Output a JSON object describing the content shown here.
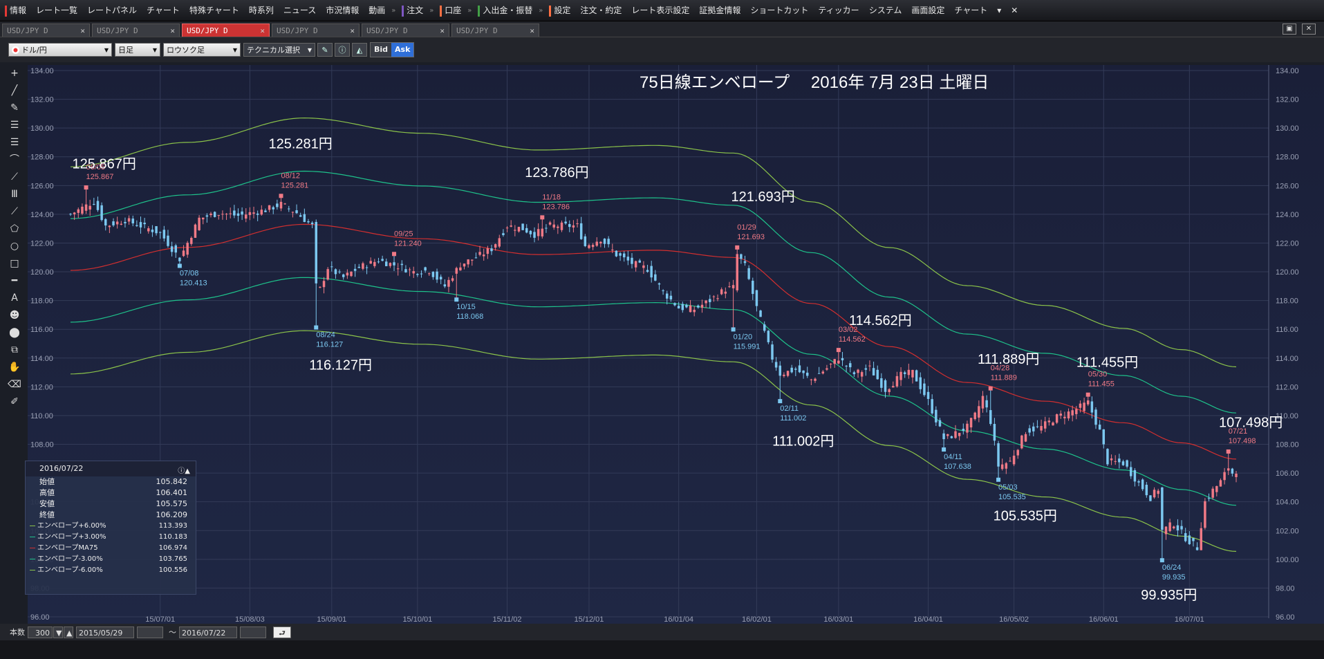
{
  "menu": {
    "items": [
      "情報",
      "レート一覧",
      "レートパネル",
      "チャート",
      "特殊チャート",
      "時系列",
      "ニュース",
      "市況情報",
      "動画",
      "注文",
      "口座",
      "入出金・振替",
      "設定",
      "注文・約定",
      "レート表示設定",
      "証拠金情報",
      "ショートカット",
      "ティッカー",
      "システム",
      "画面設定",
      "チャート"
    ],
    "close_label": "✕"
  },
  "tabs": [
    "USD/JPY D",
    "USD/JPY D",
    "USD/JPY D",
    "USD/JPY D",
    "USD/JPY D",
    "USD/JPY D"
  ],
  "active_tab": 2,
  "toolbar": {
    "pair": "ドル/円",
    "timeframe": "日足",
    "chart_type": "ロウソク足",
    "technical": "テクニカル選択",
    "bid": "Bid",
    "ask": "Ask"
  },
  "sidebar_tools": [
    "crosshair-tool",
    "trendline-tool",
    "ruler-tool",
    "parallel-lines-tool",
    "horizontal-lines-tool",
    "fibonacci-arc-tool",
    "fan-tool",
    "vertical-lines-tool",
    "channel-tool",
    "pentagon-tool",
    "circle-tool",
    "rectangle-tool",
    "hline-tool",
    "text-tool",
    "icon-tool",
    "object-tool",
    "copy-tool",
    "hand-tool",
    "eraser-tool",
    "edit-tool"
  ],
  "sidebar_glyphs": [
    "+",
    "╱",
    "✎",
    "☰",
    "☰",
    "⌒",
    "⟋",
    "Ⅲ",
    "⟋",
    "⬠",
    "○",
    "□",
    "━",
    "A",
    "☻",
    "⬤",
    "⧉",
    "✋",
    "⌫",
    "✐"
  ],
  "info_panel": {
    "date": "2016/07/22",
    "rows": [
      {
        "label": "始値",
        "value": "105.842"
      },
      {
        "label": "高値",
        "value": "106.401"
      },
      {
        "label": "安値",
        "value": "105.575"
      },
      {
        "label": "終値",
        "value": "106.209"
      }
    ],
    "series_rows": [
      {
        "label": "エンベロープ+6.00%",
        "value": "113.393",
        "color": "#8bc34a"
      },
      {
        "label": "エンベロープ+3.00%",
        "value": "110.183",
        "color": "#1ec28b"
      },
      {
        "label": "エンベロープMA75",
        "value": "106.974",
        "color": "#d32f2f"
      },
      {
        "label": "エンベロープ-3.00%",
        "value": "103.765",
        "color": "#1ec28b"
      },
      {
        "label": "エンベロープ-6.00%",
        "value": "100.556",
        "color": "#8bc34a"
      }
    ]
  },
  "bottom": {
    "count_label": "本数",
    "count_value": "300",
    "from_date": "2015/05/29",
    "tilde": "〜",
    "to_date": "2016/07/22"
  },
  "colors": {
    "up": "#f07a86",
    "down": "#7cc8f0",
    "ma": "#d32f2f",
    "env3": "#1ec28b",
    "env6": "#8bc34a",
    "bg": "#1a2038"
  },
  "chart_data": {
    "type": "candlestick",
    "title": "75日線エンベロープ　 2016年 7月 23日 土曜日",
    "ylim": [
      96,
      134
    ],
    "y_ticks": [
      "134.00",
      "132.00",
      "130.00",
      "128.00",
      "126.00",
      "124.00",
      "122.00",
      "120.00",
      "118.00",
      "116.00",
      "114.00",
      "112.00",
      "110.00",
      "108.00",
      "106.00",
      "104.00",
      "102.00",
      "100.00",
      "98.00",
      "96.00"
    ],
    "x_ticks": [
      "15/07/01",
      "15/08/03",
      "15/09/01",
      "15/10/01",
      "15/11/02",
      "15/12/01",
      "16/01/04",
      "16/02/01",
      "16/03/01",
      "16/04/01",
      "16/05/02",
      "16/06/01",
      "16/07/01"
    ],
    "x_tick_index": [
      23,
      46,
      67,
      89,
      112,
      133,
      156,
      176,
      197,
      220,
      242,
      265,
      287
    ],
    "bars": 300,
    "anchors": [
      {
        "i": 0,
        "p": 124.0
      },
      {
        "i": 6,
        "p": 124.9
      },
      {
        "i": 9,
        "p": 123.2
      },
      {
        "i": 14,
        "p": 123.6
      },
      {
        "i": 18,
        "p": 123.2
      },
      {
        "i": 23,
        "p": 122.7
      },
      {
        "i": 28,
        "p": 120.9
      },
      {
        "i": 33,
        "p": 123.7
      },
      {
        "i": 38,
        "p": 124.1
      },
      {
        "i": 43,
        "p": 123.9
      },
      {
        "i": 50,
        "p": 124.3
      },
      {
        "i": 54,
        "p": 124.7
      },
      {
        "i": 58,
        "p": 124.1
      },
      {
        "i": 62,
        "p": 123.2
      },
      {
        "i": 63,
        "p": 119.0
      },
      {
        "i": 64,
        "p": 118.8
      },
      {
        "i": 66,
        "p": 120.3
      },
      {
        "i": 70,
        "p": 119.6
      },
      {
        "i": 74,
        "p": 120.3
      },
      {
        "i": 79,
        "p": 120.8
      },
      {
        "i": 84,
        "p": 120.4
      },
      {
        "i": 88,
        "p": 120.0
      },
      {
        "i": 92,
        "p": 120.1
      },
      {
        "i": 96,
        "p": 119.0
      },
      {
        "i": 100,
        "p": 120.5
      },
      {
        "i": 104,
        "p": 121.0
      },
      {
        "i": 108,
        "p": 121.6
      },
      {
        "i": 112,
        "p": 123.2
      },
      {
        "i": 116,
        "p": 123.0
      },
      {
        "i": 119,
        "p": 122.6
      },
      {
        "i": 123,
        "p": 123.2
      },
      {
        "i": 130,
        "p": 123.2
      },
      {
        "i": 132,
        "p": 121.8
      },
      {
        "i": 136,
        "p": 122.3
      },
      {
        "i": 140,
        "p": 121.2
      },
      {
        "i": 144,
        "p": 120.6
      },
      {
        "i": 148,
        "p": 120.2
      },
      {
        "i": 152,
        "p": 118.6
      },
      {
        "i": 156,
        "p": 117.5
      },
      {
        "i": 160,
        "p": 117.4
      },
      {
        "i": 164,
        "p": 118.0
      },
      {
        "i": 168,
        "p": 118.8
      },
      {
        "i": 170,
        "p": 118.9
      },
      {
        "i": 171,
        "p": 121.2
      },
      {
        "i": 173,
        "p": 120.4
      },
      {
        "i": 176,
        "p": 117.5
      },
      {
        "i": 180,
        "p": 114.0
      },
      {
        "i": 182,
        "p": 112.9
      },
      {
        "i": 186,
        "p": 113.2
      },
      {
        "i": 190,
        "p": 112.5
      },
      {
        "i": 194,
        "p": 113.3
      },
      {
        "i": 197,
        "p": 114.0
      },
      {
        "i": 201,
        "p": 112.9
      },
      {
        "i": 205,
        "p": 113.3
      },
      {
        "i": 209,
        "p": 111.8
      },
      {
        "i": 213,
        "p": 112.8
      },
      {
        "i": 216,
        "p": 113.0
      },
      {
        "i": 220,
        "p": 111.0
      },
      {
        "i": 224,
        "p": 108.4
      },
      {
        "i": 226,
        "p": 108.6
      },
      {
        "i": 230,
        "p": 109.2
      },
      {
        "i": 232,
        "p": 110.0
      },
      {
        "i": 234,
        "p": 111.3
      },
      {
        "i": 236,
        "p": 109.6
      },
      {
        "i": 238,
        "p": 106.5
      },
      {
        "i": 241,
        "p": 106.8
      },
      {
        "i": 245,
        "p": 108.9
      },
      {
        "i": 249,
        "p": 109.2
      },
      {
        "i": 253,
        "p": 109.9
      },
      {
        "i": 256,
        "p": 110.2
      },
      {
        "i": 259,
        "p": 110.6
      },
      {
        "i": 261,
        "p": 110.9
      },
      {
        "i": 264,
        "p": 108.9
      },
      {
        "i": 266,
        "p": 106.8
      },
      {
        "i": 270,
        "p": 106.7
      },
      {
        "i": 274,
        "p": 105.3
      },
      {
        "i": 277,
        "p": 104.3
      },
      {
        "i": 279,
        "p": 104.9
      },
      {
        "i": 280,
        "p": 102.0
      },
      {
        "i": 283,
        "p": 102.5
      },
      {
        "i": 286,
        "p": 101.5
      },
      {
        "i": 289,
        "p": 100.8
      },
      {
        "i": 291,
        "p": 104.0
      },
      {
        "i": 293,
        "p": 104.8
      },
      {
        "i": 295,
        "p": 105.4
      },
      {
        "i": 297,
        "p": 106.4
      },
      {
        "i": 298,
        "p": 106.0
      },
      {
        "i": 299,
        "p": 106.2
      }
    ],
    "price_labels": [
      {
        "i": 4,
        "text": "125.867円",
        "p": 127.2,
        "dx": -20
      },
      {
        "i": 54,
        "text": "125.281円",
        "p": 128.6,
        "dx": -18
      },
      {
        "i": 63,
        "text": "116.127円",
        "p": 113.2,
        "dx": -10
      },
      {
        "i": 121,
        "text": "123.786円",
        "p": 126.6,
        "dx": -25
      },
      {
        "i": 173,
        "text": "121.693円",
        "p": 124.9,
        "dx": -20
      },
      {
        "i": 188,
        "text": "111.002円",
        "p": 107.9,
        "dx": -45
      },
      {
        "i": 205,
        "text": "114.562円",
        "p": 116.3,
        "dx": -30
      },
      {
        "i": 238,
        "text": "111.889円",
        "p": 113.6,
        "dx": -30
      },
      {
        "i": 242,
        "text": "105.535円",
        "p": 102.7,
        "dx": -30
      },
      {
        "i": 266,
        "text": "111.455円",
        "p": 113.4,
        "dx": -45
      },
      {
        "i": 279,
        "text": "99.935円",
        "p": 97.2,
        "dx": -25
      },
      {
        "i": 299,
        "text": "107.498円",
        "p": 109.2,
        "dx": -25
      }
    ],
    "peak_labels": [
      {
        "i": 4,
        "date": "06/05",
        "value": "125.867",
        "p": 125.867,
        "kind": "high"
      },
      {
        "i": 28,
        "date": "07/08",
        "value": "120.413",
        "p": 120.413,
        "kind": "low"
      },
      {
        "i": 54,
        "date": "08/12",
        "value": "125.281",
        "p": 125.281,
        "kind": "high"
      },
      {
        "i": 63,
        "date": "08/24",
        "value": "116.127",
        "p": 116.127,
        "kind": "low"
      },
      {
        "i": 83,
        "date": "09/25",
        "value": "121.240",
        "p": 121.24,
        "kind": "high"
      },
      {
        "i": 99,
        "date": "10/15",
        "value": "118.068",
        "p": 118.068,
        "kind": "low"
      },
      {
        "i": 121,
        "date": "11/18",
        "value": "123.786",
        "p": 123.786,
        "kind": "high"
      },
      {
        "i": 170,
        "date": "01/20",
        "value": "115.991",
        "p": 115.991,
        "kind": "low"
      },
      {
        "i": 171,
        "date": "01/29",
        "value": "121.693",
        "p": 121.693,
        "kind": "high"
      },
      {
        "i": 182,
        "date": "02/11",
        "value": "111.002",
        "p": 111.002,
        "kind": "low"
      },
      {
        "i": 197,
        "date": "03/02",
        "value": "114.562",
        "p": 114.562,
        "kind": "high"
      },
      {
        "i": 224,
        "date": "04/11",
        "value": "107.638",
        "p": 107.638,
        "kind": "low"
      },
      {
        "i": 236,
        "date": "04/28",
        "value": "111.889",
        "p": 111.889,
        "kind": "high"
      },
      {
        "i": 238,
        "date": "05/03",
        "value": "105.535",
        "p": 105.535,
        "kind": "low"
      },
      {
        "i": 261,
        "date": "05/30",
        "value": "111.455",
        "p": 111.455,
        "kind": "high"
      },
      {
        "i": 280,
        "date": "06/24",
        "value": "99.935",
        "p": 99.935,
        "kind": "low"
      },
      {
        "i": 297,
        "date": "07/21",
        "value": "107.498",
        "p": 107.498,
        "kind": "high"
      }
    ],
    "ma75": [
      {
        "i": 0,
        "p": 120.1
      },
      {
        "i": 30,
        "p": 121.7
      },
      {
        "i": 60,
        "p": 123.3
      },
      {
        "i": 90,
        "p": 122.3
      },
      {
        "i": 120,
        "p": 121.2
      },
      {
        "i": 150,
        "p": 121.5
      },
      {
        "i": 170,
        "p": 121.0
      },
      {
        "i": 190,
        "p": 117.8
      },
      {
        "i": 210,
        "p": 114.8
      },
      {
        "i": 230,
        "p": 112.3
      },
      {
        "i": 250,
        "p": 111.0
      },
      {
        "i": 270,
        "p": 109.5
      },
      {
        "i": 285,
        "p": 108.1
      },
      {
        "i": 299,
        "p": 106.97
      }
    ]
  }
}
